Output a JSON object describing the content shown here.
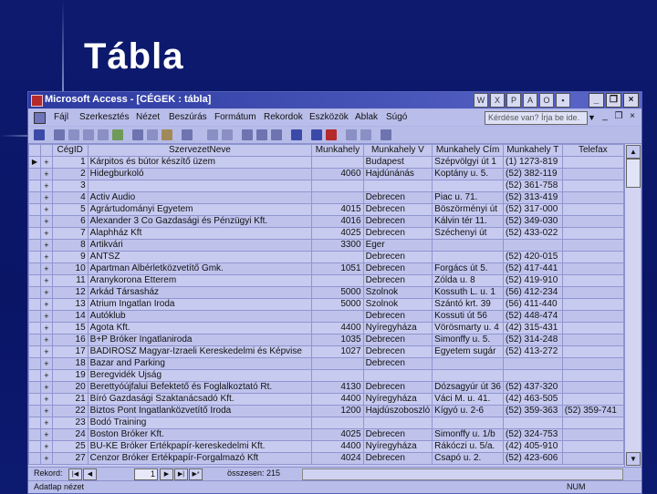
{
  "slide": {
    "title": "Tábla"
  },
  "window": {
    "title": "Microsoft Access - [CÉGEK : tábla]"
  },
  "menu": {
    "items": [
      "Fájl",
      "Szerkesztés",
      "Nézet",
      "Beszúrás",
      "Formátum",
      "Rekordok",
      "Eszközök",
      "Ablak",
      "Súgó"
    ],
    "help_placeholder": "Kérdése van? Írja be ide."
  },
  "table": {
    "columns": [
      "CégID",
      "SzervezetNeve",
      "Munkahely",
      "Munkahely V",
      "Munkahely Cím",
      "Munkahely T",
      "Telefax"
    ],
    "rows": [
      {
        "id": "1",
        "name": "Kárpitos és bútor készítő üzem",
        "zip": "",
        "city": "Budapest",
        "addr": "Szépvölgyi út 1",
        "tel": "(1) 1273-819",
        "fax": ""
      },
      {
        "id": "2",
        "name": "Hidegburkoló",
        "zip": "4060",
        "city": "Hajdúnánás",
        "addr": "Koptány u. 5.",
        "tel": "(52) 382-119",
        "fax": ""
      },
      {
        "id": "3",
        "name": "",
        "zip": "",
        "city": "",
        "addr": "",
        "tel": "(52) 361-758",
        "fax": ""
      },
      {
        "id": "4",
        "name": "Activ Audio",
        "zip": "",
        "city": "Debrecen",
        "addr": "Piac u. 71.",
        "tel": "(52) 313-419",
        "fax": ""
      },
      {
        "id": "5",
        "name": "Agrártudományi Egyetem",
        "zip": "4015",
        "city": "Debrecen",
        "addr": "Böszörményi út",
        "tel": "(52) 317-000",
        "fax": ""
      },
      {
        "id": "6",
        "name": "Alexander 3 Co Gazdasági és Pénzügyi Kft.",
        "zip": "4016",
        "city": "Debrecen",
        "addr": "Kálvin tér 11.",
        "tel": "(52) 349-030",
        "fax": ""
      },
      {
        "id": "7",
        "name": "Alaphház Kft",
        "zip": "4025",
        "city": "Debrecen",
        "addr": "Széchenyi út",
        "tel": "(52) 433-022",
        "fax": ""
      },
      {
        "id": "8",
        "name": "Artikvári",
        "zip": "3300",
        "city": "Eger",
        "addr": "",
        "tel": "",
        "fax": ""
      },
      {
        "id": "9",
        "name": "ÁNTSZ",
        "zip": "",
        "city": "Debrecen",
        "addr": "",
        "tel": "(52) 420-015",
        "fax": ""
      },
      {
        "id": "10",
        "name": "Apartman Albérletközvetítő Gmk.",
        "zip": "1051",
        "city": "Debrecen",
        "addr": "Forgács út 5.",
        "tel": "(52) 417-441",
        "fax": ""
      },
      {
        "id": "11",
        "name": "Aranykorona Étterem",
        "zip": "",
        "city": "Debrecen",
        "addr": "Zólda u. 8",
        "tel": "(52) 419-910",
        "fax": ""
      },
      {
        "id": "12",
        "name": "Arkád Társasház",
        "zip": "5000",
        "city": "Szolnok",
        "addr": "Kossuth L. u. 1",
        "tel": "(56) 412-234",
        "fax": ""
      },
      {
        "id": "13",
        "name": "Átrium Ingatlan Iroda",
        "zip": "5000",
        "city": "Szolnok",
        "addr": "Szántó krt. 39",
        "tel": "(56) 411-440",
        "fax": ""
      },
      {
        "id": "14",
        "name": "Autóklub",
        "zip": "",
        "city": "Debrecen",
        "addr": "Kossuti út 56",
        "tel": "(52) 448-474",
        "fax": ""
      },
      {
        "id": "15",
        "name": "Ágota Kft.",
        "zip": "4400",
        "city": "Nyíregyháza",
        "addr": "Vörösmarty u. 4",
        "tel": "(42) 315-431",
        "fax": ""
      },
      {
        "id": "16",
        "name": "B+P Bróker Ingatlaniroda",
        "zip": "1035",
        "city": "Debrecen",
        "addr": "Simonffy u. 5.",
        "tel": "(52) 314-248",
        "fax": ""
      },
      {
        "id": "17",
        "name": "BADIROSZ Magyar-Izraeli Kereskedelmi és Képvise",
        "zip": "1027",
        "city": "Debrecen",
        "addr": "Egyetem sugár",
        "tel": "(52) 413-272",
        "fax": ""
      },
      {
        "id": "18",
        "name": "Bazar and Parking",
        "zip": "",
        "city": "Debrecen",
        "addr": "",
        "tel": "",
        "fax": ""
      },
      {
        "id": "19",
        "name": "Beregvidék Ujság",
        "zip": "",
        "city": "",
        "addr": "",
        "tel": "",
        "fax": ""
      },
      {
        "id": "20",
        "name": "Berettyóújfalui Befektető és Foglalkoztató Rt.",
        "zip": "4130",
        "city": "Debrecen",
        "addr": "Dózsagyúr út 36",
        "tel": "(52) 437-320",
        "fax": ""
      },
      {
        "id": "21",
        "name": "Bíró Gazdasági Szaktanácsadó Kft.",
        "zip": "4400",
        "city": "Nyíregyháza",
        "addr": "Váci M. u. 41.",
        "tel": "(42) 463-505",
        "fax": ""
      },
      {
        "id": "22",
        "name": "Biztos Pont Ingatlanközvetítő Iroda",
        "zip": "1200",
        "city": "Hajdúszoboszló",
        "addr": "Kígyó u. 2-6",
        "tel": "(52) 359-363",
        "fax": "(52) 359-741"
      },
      {
        "id": "23",
        "name": "Bodó Training",
        "zip": "",
        "city": "",
        "addr": "",
        "tel": "",
        "fax": ""
      },
      {
        "id": "24",
        "name": "Boston Bróker Kft.",
        "zip": "4025",
        "city": "Debrecen",
        "addr": "Simonffy u. 1/b",
        "tel": "(52) 324-753",
        "fax": ""
      },
      {
        "id": "25",
        "name": "BU-KE Bróker Értékpapír-kereskedelmi Kft.",
        "zip": "4400",
        "city": "Nyíregyháza",
        "addr": "Rákóczi u. 5/a.",
        "tel": "(42) 405-910",
        "fax": ""
      },
      {
        "id": "27",
        "name": "Cenzor Bróker Értékpapír-Forgalmazó Kft",
        "zip": "4024",
        "city": "Debrecen",
        "addr": "Csapó u. 2.",
        "tel": "(52) 423-606",
        "fax": ""
      }
    ]
  },
  "navigation": {
    "record_label": "Rekord:",
    "current_record": "1",
    "total_label": "összesen: 215"
  },
  "status": {
    "left": "Adatlap nézet",
    "right": "NUM"
  }
}
